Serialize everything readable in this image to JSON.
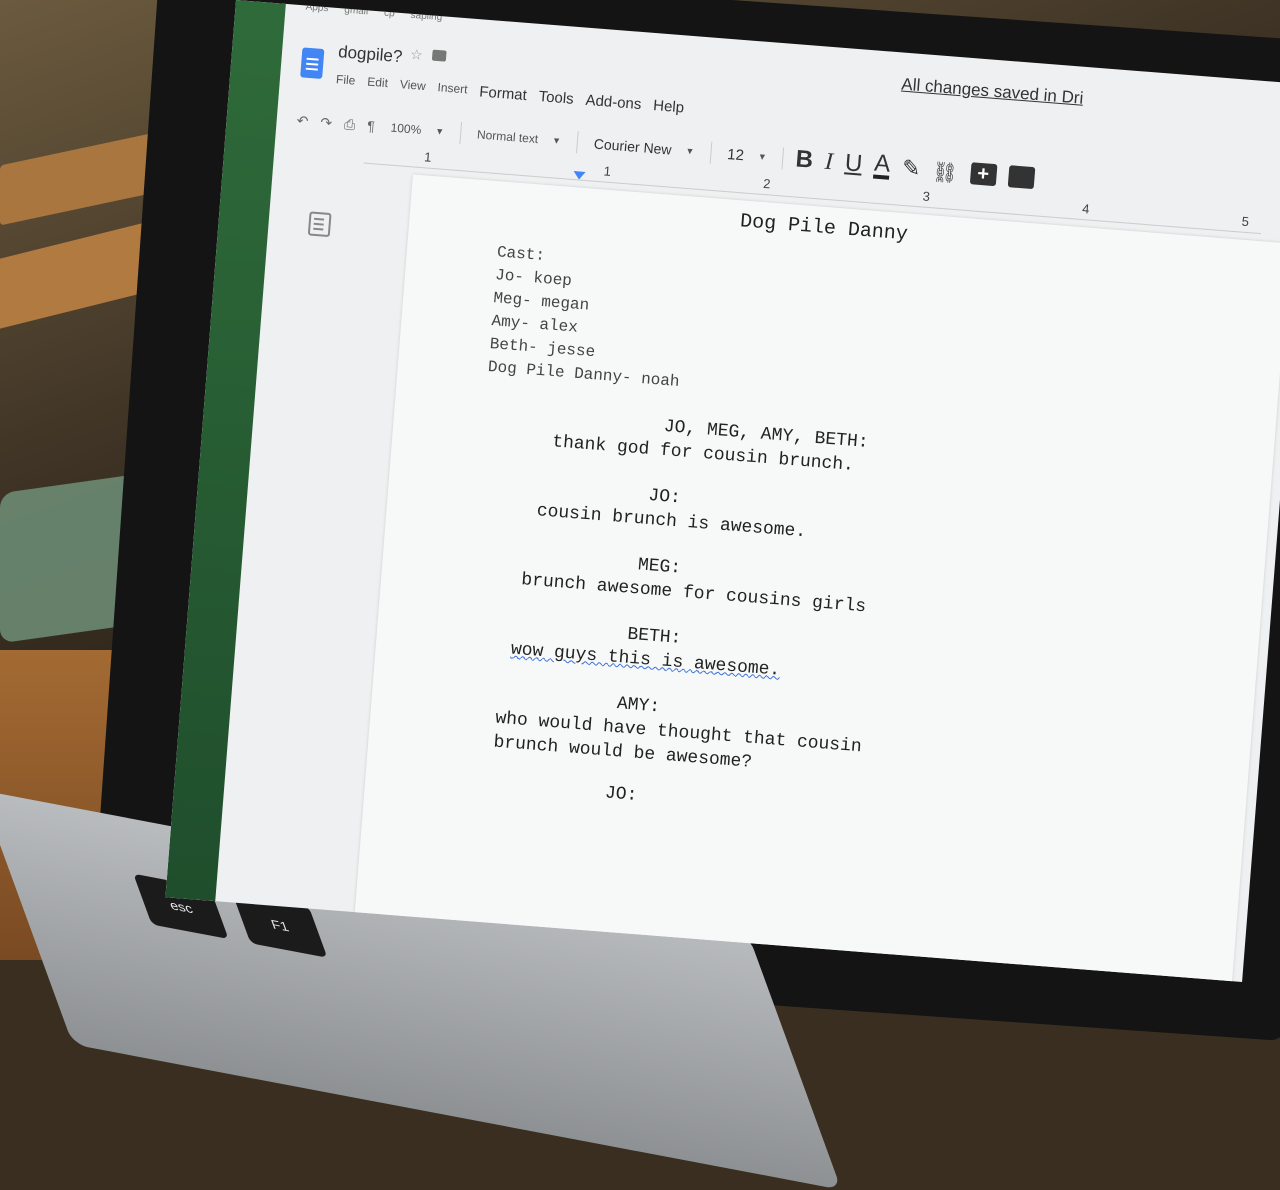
{
  "bookmarks": [
    "Apps",
    "gmail",
    "cp",
    "sapling"
  ],
  "doc": {
    "title": "dogpile?",
    "saved_status": "All changes saved in Dri",
    "menu": [
      "File",
      "Edit",
      "View",
      "Insert",
      "Format",
      "Tools",
      "Add-ons",
      "Help"
    ]
  },
  "toolbar": {
    "zoom": "100%",
    "style": "Normal text",
    "font": "Courier New",
    "size": "12",
    "bold": "B",
    "italic": "I",
    "underline": "U",
    "text_color": "A"
  },
  "ruler_numbers": [
    "1",
    "1",
    "2",
    "3",
    "4",
    "5"
  ],
  "script": {
    "title": "Dog Pile Danny",
    "cast_heading": "Cast:",
    "cast": [
      "Jo- koep",
      "Meg- megan",
      "Amy- alex",
      "Beth- jesse",
      "Dog Pile Danny- noah"
    ],
    "lines": [
      {
        "speaker": "JO, MEG, AMY, BETH:",
        "text": [
          "thank god for cousin brunch."
        ]
      },
      {
        "speaker": "JO:",
        "text": [
          "cousin brunch is awesome."
        ]
      },
      {
        "speaker": "MEG:",
        "text": [
          "brunch awesome for cousins girls"
        ]
      },
      {
        "speaker": "BETH:",
        "text": [
          "wow guys this is awesome."
        ]
      },
      {
        "speaker": "AMY:",
        "text": [
          "who would have thought that cousin",
          "brunch would be awesome?"
        ]
      },
      {
        "speaker": "JO:",
        "text": []
      }
    ]
  },
  "keys": [
    "esc",
    "F1"
  ]
}
